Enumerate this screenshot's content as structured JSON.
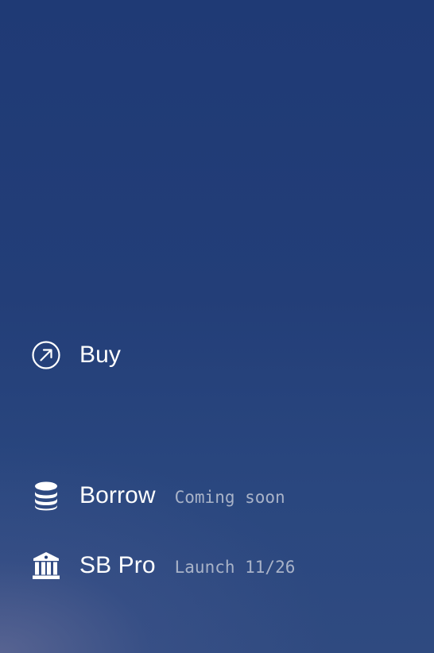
{
  "menu": {
    "items": [
      {
        "label": "Buy",
        "badge": "",
        "icon": "arrow-up-right-circle-icon"
      },
      {
        "label": "Borrow",
        "badge": "Coming soon",
        "icon": "coin-stack-icon"
      },
      {
        "label": "SB Pro",
        "badge": "Launch 11/26",
        "icon": "bank-building-icon"
      }
    ]
  },
  "colors": {
    "background_top": "#1f3a75",
    "background_bottom": "#2f4a80",
    "text": "#ffffff",
    "badge_text": "#a9b3c8"
  }
}
